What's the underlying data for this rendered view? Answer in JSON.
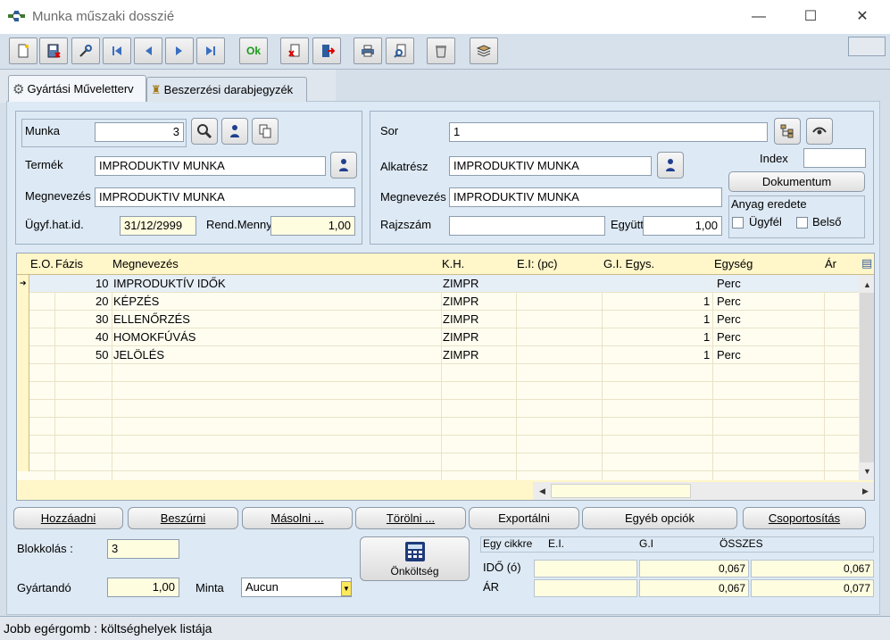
{
  "window": {
    "title": "Munka műszaki dosszié",
    "controls": {
      "minimize": "—",
      "maximize": "☐",
      "close": "✕"
    }
  },
  "toolbar": {
    "buttons": [
      "new-icon",
      "save-icon",
      "tools-icon",
      "first-icon",
      "prev-icon",
      "next-icon",
      "last-icon",
      "ok-icon",
      "delete-doc-icon",
      "exit-icon",
      "print-icon",
      "preview-icon",
      "trash-icon",
      "book-icon"
    ],
    "ok_label": "Ok"
  },
  "tabs": [
    {
      "label": "Gyártási Műveletterv",
      "active": true
    },
    {
      "label": "Beszerzési darabjegyzék",
      "active": false
    }
  ],
  "left_group": {
    "munka_label": "Munka",
    "munka_value": "3",
    "termek_label": "Termék",
    "termek_value": "IMPRODUKTIV MUNKA",
    "megnevezes_label": "Megnevezés",
    "megnevezes_value": "IMPRODUKTIV MUNKA",
    "ugyf_label": "Ügyf.hat.id.",
    "ugyf_value": "31/12/2999",
    "rend_label": "Rend.Menny.",
    "rend_value": "1,00"
  },
  "right_group": {
    "sor_label": "Sor",
    "sor_value": "1",
    "alkatresz_label": "Alkatrész",
    "alkatresz_value": "IMPRODUKTIV MUNKA",
    "megnevezes_label": "Megnevezés",
    "megnevezes_value": "IMPRODUKTIV MUNKA",
    "rajzszam_label": "Rajzszám",
    "rajzszam_value": "",
    "egyutt_label": "Együtt",
    "egyutt_value": "1,00",
    "index_label": "Index",
    "index_value": "",
    "dokumentum_label": "Dokumentum",
    "anyag_title": "Anyag eredete",
    "ugyfel_label": "Ügyfél",
    "belso_label": "Belső"
  },
  "grid": {
    "headers": [
      "E.O.",
      "Fázis",
      "Megnevezés",
      "K.H.",
      "E.I: (pc)",
      "G.I. Egys.",
      "Egység",
      "Ár"
    ],
    "rows": [
      {
        "fazis": "10",
        "megnevezes": "IMPRODUKTÍV IDŐK",
        "kh": "ZIMPR",
        "ei": "",
        "gi": "",
        "egyseg": "Perc"
      },
      {
        "fazis": "20",
        "megnevezes": "KÉPZÉS",
        "kh": "ZIMPR",
        "ei": "",
        "gi": "1",
        "egyseg": "Perc"
      },
      {
        "fazis": "30",
        "megnevezes": "ELLENŐRZÉS",
        "kh": "ZIMPR",
        "ei": "",
        "gi": "1",
        "egyseg": "Perc"
      },
      {
        "fazis": "40",
        "megnevezes": "HOMOKFÚVÁS",
        "kh": "ZIMPR",
        "ei": "",
        "gi": "1",
        "egyseg": "Perc"
      },
      {
        "fazis": "50",
        "megnevezes": "JELÖLÉS",
        "kh": "ZIMPR",
        "ei": "",
        "gi": "1",
        "egyseg": "Perc"
      }
    ]
  },
  "actions": {
    "hozzaadni": "Hozzáadni",
    "beszurni": "Beszúrni",
    "masolni": "Másolni ...",
    "torolni": "Törölni ...",
    "exportalni": "Exportálni",
    "egyeb": "Egyéb opciók",
    "csoportositas": "Csoportosítás"
  },
  "bottom": {
    "blokkolas_label": "Blokkolás :",
    "blokkolas_value": "3",
    "gyartando_label": "Gyártandó",
    "gyartando_value": "1,00",
    "minta_label": "Minta",
    "minta_value": "Aucun",
    "onkoltseg_label": "Önköltség"
  },
  "cost": {
    "head": {
      "egy_cikkre": "Egy cikkre",
      "ei": "E.I.",
      "gi": "G.I",
      "osszes": "ÖSSZES"
    },
    "ido_label": "IDŐ (ó)",
    "ar_label": "ÁR",
    "ido": {
      "ei": "",
      "gi": "0,067",
      "osszes": "0,067"
    },
    "ar": {
      "ei": "",
      "gi": "0,067",
      "osszes": "0,077"
    }
  },
  "status": {
    "text": "Jobb egérgomb : költséghelyek listája"
  }
}
